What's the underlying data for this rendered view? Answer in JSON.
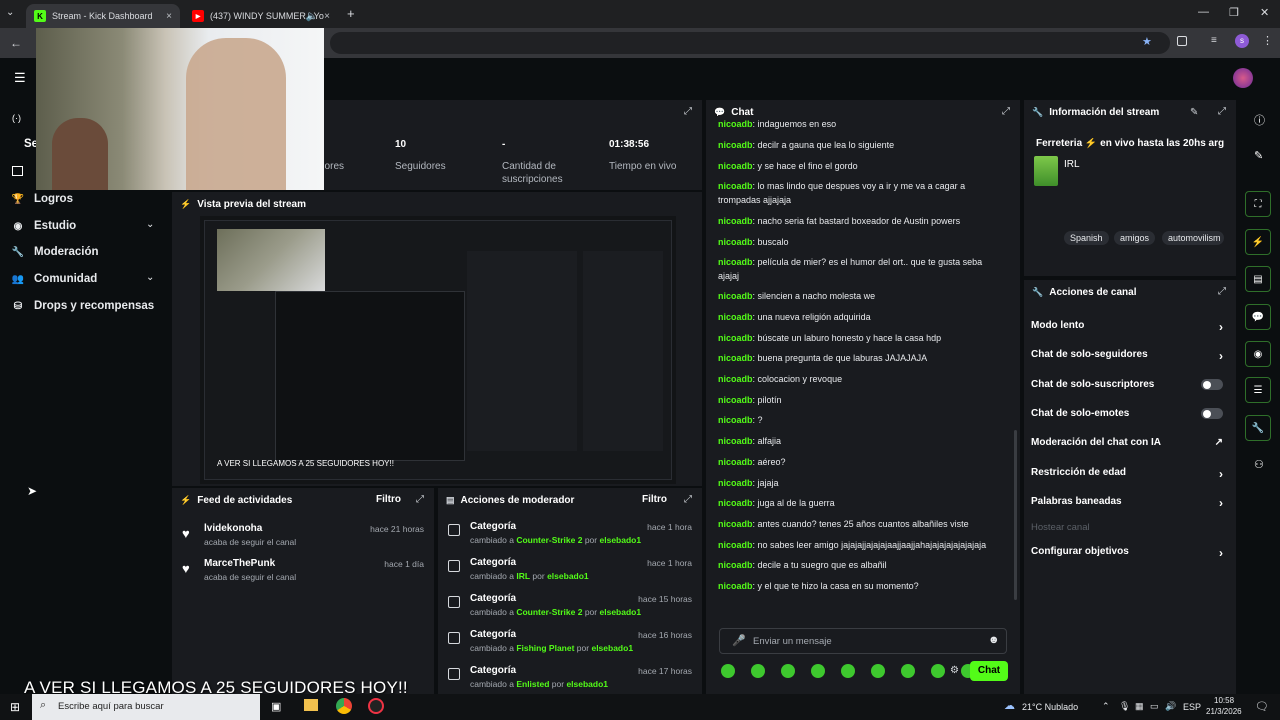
{
  "browser": {
    "tabs": [
      {
        "title": "Stream - Kick Dashboard",
        "active": true
      },
      {
        "title": "(437) WINDY SUMMER - Yo",
        "active": false
      }
    ],
    "new_tab": "+",
    "close": "×"
  },
  "sidebar": {
    "items": [
      {
        "label": "Logros",
        "icon": "trophy-icon"
      },
      {
        "label": "Estudio",
        "icon": "studio-icon",
        "expandable": true
      },
      {
        "label": "Moderación",
        "icon": "wrench-icon"
      },
      {
        "label": "Comunidad",
        "icon": "community-icon",
        "expandable": true
      },
      {
        "label": "Drops y recompensas",
        "icon": "drops-icon"
      }
    ]
  },
  "stats": [
    {
      "value": "",
      "label": "dores"
    },
    {
      "value": "10",
      "label": "Seguidores"
    },
    {
      "value": "-",
      "label": "Cantidad de suscripciones"
    },
    {
      "value": "01:38:56",
      "label": "Tiempo en vivo"
    }
  ],
  "preview": {
    "title": "Vista previa del stream"
  },
  "overlay_text": "A VER SI LLEGAMOS A 25 SEGUIDORES HOY!!",
  "activity_feed": {
    "title": "Feed de actividades",
    "filter": "Filtro",
    "items": [
      {
        "name": "lvidekonoha",
        "sub": "acaba de seguir el canal",
        "time": "hace 21 horas"
      },
      {
        "name": "MarceThePunk",
        "sub": "acaba de seguir el canal",
        "time": "hace 1 día"
      }
    ]
  },
  "mod_actions": {
    "title": "Acciones de moderador",
    "filter": "Filtro",
    "items": [
      {
        "title": "Categoría",
        "prefix": "cambiado a",
        "value": "Counter-Strike 2",
        "by": "por",
        "user": "elsebado1",
        "time": "hace 1 hora"
      },
      {
        "title": "Categoría",
        "prefix": "cambiado a",
        "value": "IRL",
        "by": "por",
        "user": "elsebado1",
        "time": "hace 1 hora"
      },
      {
        "title": "Categoría",
        "prefix": "cambiado a",
        "value": "Counter-Strike 2",
        "by": "por",
        "user": "elsebado1",
        "time": "hace 15 horas"
      },
      {
        "title": "Categoría",
        "prefix": "cambiado a",
        "value": "Fishing Planet",
        "by": "por",
        "user": "elsebado1",
        "time": "hace 16 horas"
      },
      {
        "title": "Categoría",
        "prefix": "cambiado a",
        "value": "Enlisted",
        "by": "por",
        "user": "elsebado1",
        "time": "hace 17 horas"
      }
    ]
  },
  "chat": {
    "title": "Chat",
    "placeholder": "Enviar un mensaje",
    "send": "Chat",
    "messages": [
      {
        "user": "nicoadb",
        "text": "indaguemos en eso"
      },
      {
        "user": "nicoadb",
        "text": "decilr a gauna que lea lo siguiente"
      },
      {
        "user": "nicoadb",
        "text": "y se hace el fino el gordo"
      },
      {
        "user": "nicoadb",
        "text": "lo mas lindo que despues voy a ir y me va a cagar a trompadas ajjajaja"
      },
      {
        "user": "nicoadb",
        "text": "nacho seria fat bastard boxeador de Austin powers"
      },
      {
        "user": "nicoadb",
        "text": "buscalo"
      },
      {
        "user": "nicoadb",
        "text": "película de mier? es el humor del ort.. que te gusta seba ajajaj"
      },
      {
        "user": "nicoadb",
        "text": "silencien a nacho molesta we"
      },
      {
        "user": "nicoadb",
        "text": "una nueva religión adquirida"
      },
      {
        "user": "nicoadb",
        "text": "búscate un laburo honesto y hace la casa hdp"
      },
      {
        "user": "nicoadb",
        "text": "buena pregunta de que laburas JAJAJAJA"
      },
      {
        "user": "nicoadb",
        "text": "colocacion y revoque"
      },
      {
        "user": "nicoadb",
        "text": "pilotín"
      },
      {
        "user": "nicoadb",
        "text": "?"
      },
      {
        "user": "nicoadb",
        "text": "alfajia"
      },
      {
        "user": "nicoadb",
        "text": "aéreo?"
      },
      {
        "user": "nicoadb",
        "text": "jajaja"
      },
      {
        "user": "nicoadb",
        "text": "juga al de la guerra"
      },
      {
        "user": "nicoadb",
        "text": "antes cuando? tenes 25 años cuantos albañiles viste"
      },
      {
        "user": "nicoadb",
        "text": "no sabes leer amigo jajajajjajajajaajjaajjahajajajajajajajaja"
      },
      {
        "user": "nicoadb",
        "text": "decile a tu suegro que es albañil"
      },
      {
        "user": "nicoadb",
        "text": "y el que te hizo la casa en su momento?"
      }
    ]
  },
  "stream_info": {
    "title": "Información del stream",
    "stream_title": "Ferreteria ⚡ en vivo hasta las 20hs arg",
    "category": "IRL",
    "tags": [
      "Spanish",
      "amigos",
      "automovilism"
    ]
  },
  "channel_actions": {
    "title": "Acciones de canal",
    "items": [
      {
        "label": "Modo lento",
        "control": "chevron"
      },
      {
        "label": "Chat de solo-seguidores",
        "control": "chevron"
      },
      {
        "label": "Chat de solo-suscriptores",
        "control": "toggle"
      },
      {
        "label": "Chat de solo-emotes",
        "control": "toggle"
      },
      {
        "label": "Moderación del chat con IA",
        "control": "external"
      },
      {
        "label": "Restricción de edad",
        "control": "chevron"
      },
      {
        "label": "Palabras baneadas",
        "control": "chevron"
      },
      {
        "label": "Hostear canal",
        "control": "disabled"
      },
      {
        "label": "Configurar objetivos",
        "control": "chevron"
      }
    ]
  },
  "taskbar": {
    "search_placeholder": "Escribe aquí para buscar",
    "weather": "21°C  Nublado",
    "lang": "ESP",
    "time": "10:58",
    "date": "21/3/2026"
  },
  "colors": {
    "accent": "#53fc18",
    "panel": "#191b1f",
    "bg": "#0b0e10"
  }
}
